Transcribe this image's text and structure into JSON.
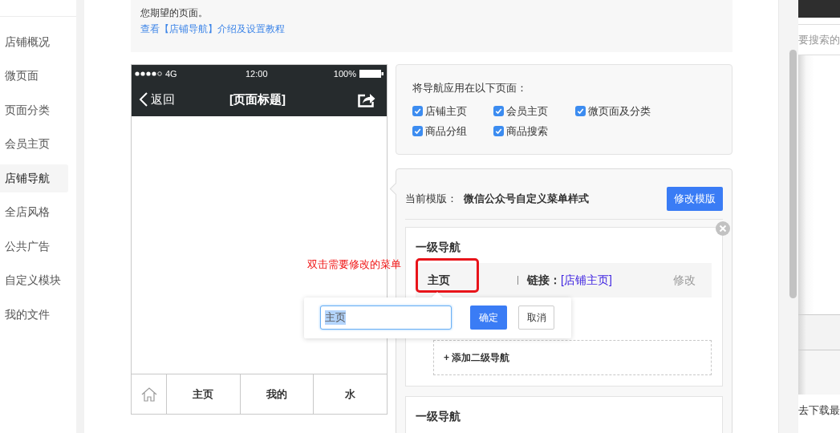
{
  "sidebar": {
    "items": [
      {
        "label": "店铺概况",
        "selected": false
      },
      {
        "label": "微页面",
        "selected": false
      },
      {
        "label": "页面分类",
        "selected": false
      },
      {
        "label": "会员主页",
        "selected": false
      },
      {
        "label": "店铺导航",
        "selected": true
      },
      {
        "label": "全店风格",
        "selected": false
      },
      {
        "label": "公共广告",
        "selected": false
      },
      {
        "label": "自定义模块",
        "selected": false
      },
      {
        "label": "我的文件",
        "selected": false
      }
    ]
  },
  "notice": {
    "text": "您期望的页面。",
    "link": "查看【店铺导航】介绍及设置教程"
  },
  "phone": {
    "status_bar": {
      "network": "4G",
      "time": "12:00",
      "battery": "100%"
    },
    "nav_bar": {
      "back": "返回",
      "title": "[页面标题]"
    },
    "tab_bar": {
      "items": [
        "主页",
        "我的",
        "水"
      ]
    }
  },
  "apply_pages": {
    "title": "将导航应用在以下页面：",
    "options": [
      {
        "label": "店铺主页",
        "checked": true
      },
      {
        "label": "会员主页",
        "checked": true
      },
      {
        "label": "微页面及分类",
        "checked": true
      },
      {
        "label": "商品分组",
        "checked": true
      },
      {
        "label": "商品搜索",
        "checked": true
      }
    ]
  },
  "template": {
    "label": "当前模版：",
    "name": "微信公众号自定义菜单样式",
    "button": "修改模版"
  },
  "nav_cards": [
    {
      "title": "一级导航",
      "item": {
        "name": "主页",
        "link_label": "链接：",
        "link": "[店铺主页]",
        "edit": "修改"
      },
      "add_button": "+ 添加二级导航"
    },
    {
      "title": "一级导航"
    }
  ],
  "annotation": {
    "text": "双击需要修改的菜单"
  },
  "edit_popover": {
    "value": "主页",
    "text_selected": true,
    "confirm": "确定",
    "cancel": "取消"
  },
  "background_window": {
    "search_placeholder": "要搜索的",
    "footer_text": "去下载最"
  }
}
